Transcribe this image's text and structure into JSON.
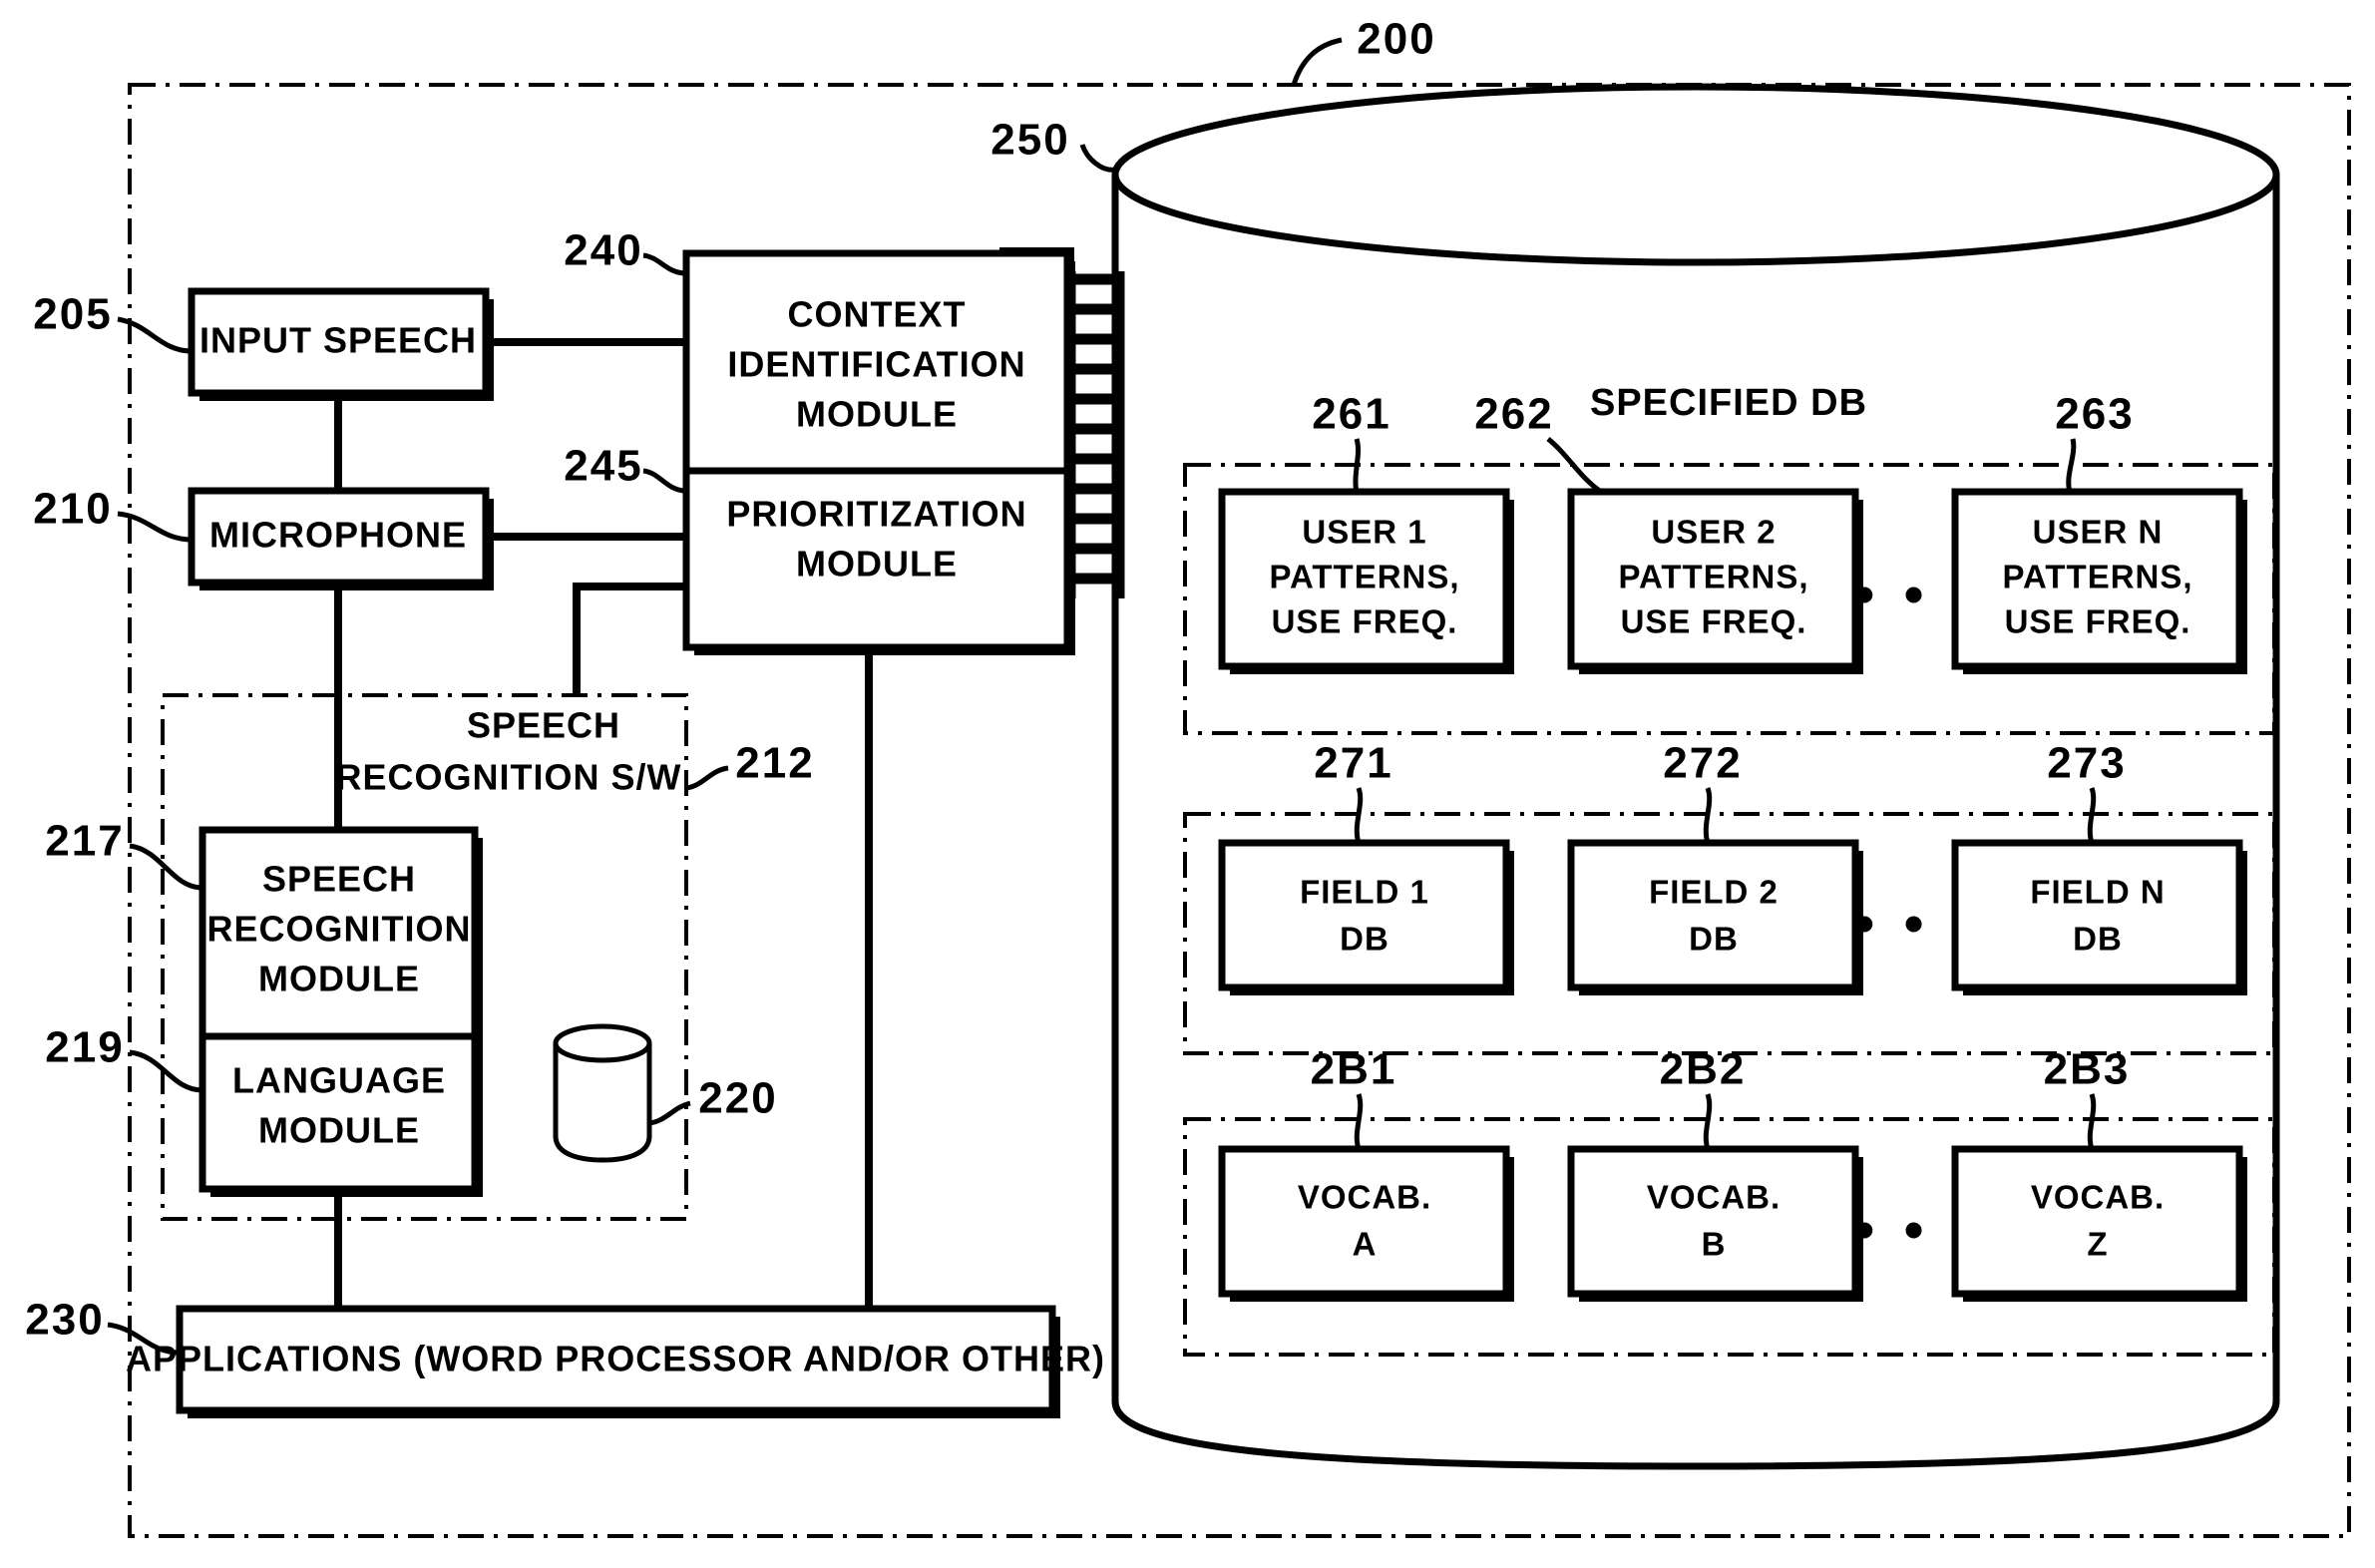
{
  "figure": {
    "title_ref": "200",
    "system_boundary_ref": "200",
    "database_ref": "250",
    "specified_db_title": "SPECIFIED DB"
  },
  "blocks": {
    "input_speech": {
      "label": "INPUT SPEECH",
      "ref": "205"
    },
    "microphone": {
      "label": "MICROPHONE",
      "ref": "210"
    },
    "context_identification": {
      "line1": "CONTEXT",
      "line2": "IDENTIFICATION",
      "line3": "MODULE",
      "ref": "240"
    },
    "prioritization": {
      "line1": "PRIORITIZATION",
      "line2": "MODULE",
      "ref": "245"
    },
    "speech_recognition_sw": {
      "line1": "SPEECH",
      "line2": "RECOGNITION S/W",
      "ref": "212"
    },
    "speech_recognition_module": {
      "line1": "SPEECH",
      "line2": "RECOGNITION",
      "line3": "MODULE",
      "ref": "217"
    },
    "language_module": {
      "line1": "LANGUAGE",
      "line2": "MODULE",
      "ref": "219"
    },
    "local_store": {
      "ref": "220"
    },
    "applications": {
      "label": "APPLICATIONS (WORD PROCESSOR AND/OR OTHER)",
      "ref": "230"
    }
  },
  "db_rows": [
    {
      "name": "user-patterns-row",
      "ellipsis": "• • •",
      "items": [
        {
          "ref": "261",
          "line1": "USER 1",
          "line2": "PATTERNS,",
          "line3": "USE FREQ."
        },
        {
          "ref": "262",
          "line1": "USER 2",
          "line2": "PATTERNS,",
          "line3": "USE FREQ."
        },
        {
          "ref": "263",
          "line1": "USER N",
          "line2": "PATTERNS,",
          "line3": "USE FREQ."
        }
      ]
    },
    {
      "name": "field-db-row",
      "ellipsis": "• • •",
      "items": [
        {
          "ref": "271",
          "line1": "FIELD 1",
          "line2": "DB",
          "line3": ""
        },
        {
          "ref": "272",
          "line1": "FIELD 2",
          "line2": "DB",
          "line3": ""
        },
        {
          "ref": "273",
          "line1": "FIELD N",
          "line2": "DB",
          "line3": ""
        }
      ]
    },
    {
      "name": "vocabulary-row",
      "ellipsis": "• • •",
      "items": [
        {
          "ref": "2B1",
          "line1": "VOCAB.",
          "line2": "A",
          "line3": ""
        },
        {
          "ref": "2B2",
          "line1": "VOCAB.",
          "line2": "B",
          "line3": ""
        },
        {
          "ref": "2B3",
          "line1": "VOCAB.",
          "line2": "Z",
          "line3": ""
        }
      ]
    }
  ],
  "colors": {
    "ink": "#000000",
    "paper": "#ffffff"
  }
}
